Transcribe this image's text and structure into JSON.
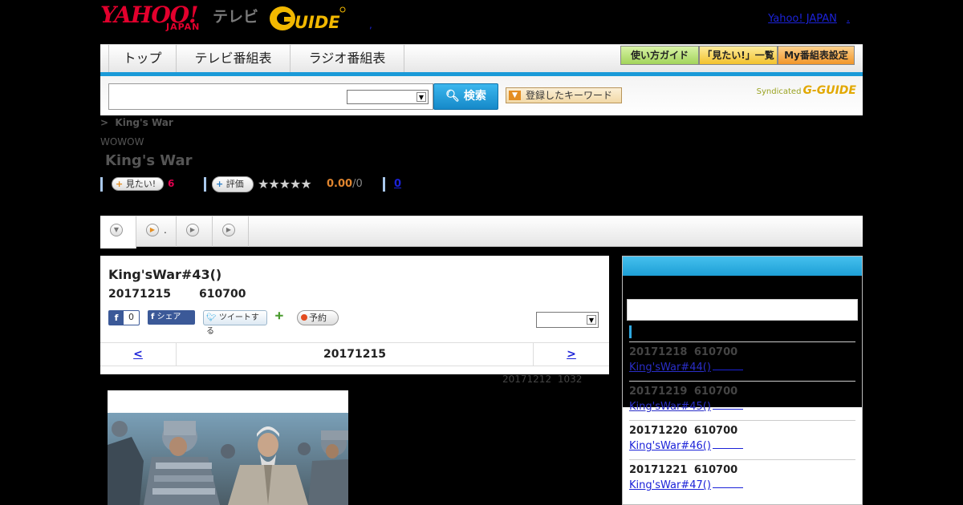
{
  "header": {
    "yahoo_logo": "YAHOO!",
    "japan_logo": "JAPAN",
    "tv_label": "テレビ",
    "gguide_logo": "G-GUIDE",
    "yahoo_japan_link": "Yahoo! JAPAN",
    "small_dot": ","
  },
  "nav": {
    "tabs": [
      {
        "label": "トップ"
      },
      {
        "label": "テレビ番組表"
      },
      {
        "label": "ラジオ番組表"
      }
    ],
    "buttons": [
      {
        "label": "使い方ガイド",
        "color": "#b5e36d"
      },
      {
        "label": "「見たい!」一覧",
        "color": "#f8d34a"
      },
      {
        "label": "My番組表設定",
        "color": "#f6a53a"
      }
    ]
  },
  "search": {
    "input_value": "",
    "select_value": "",
    "search_button": "検索",
    "keyword_button": "登録したキーワード",
    "syndicated_label": "Syndicated",
    "syndicated_brand": "G-GUIDE"
  },
  "breadcrumb": {
    "separator": ">",
    "current": "King's War"
  },
  "program": {
    "station": "WOWOW",
    "title": "King's War",
    "mitai_button": "見たい!",
    "mitai_count": "6",
    "hyouka_button": "評価",
    "stars": "★★★★★",
    "rating": 0.0,
    "score": "0.00",
    "score_count": "/0",
    "comment_count": "0"
  },
  "tabs": {
    "dot_label": "."
  },
  "episode": {
    "title": "King'sWar#43()",
    "date": "20171215",
    "time": "610700",
    "fb_like_count": "0",
    "fb_share": "シェア",
    "tweet": "ツイートする",
    "reserve": "予約",
    "select_value": "",
    "pager_prev": "<",
    "pager_current": "20171215",
    "pager_next": ">",
    "updated": "20171212  1032"
  },
  "sidebar": {
    "input_value": "",
    "items": [
      {
        "date": "20171218  610700",
        "link": "King'sWar#44()"
      },
      {
        "date": "20171219  610700",
        "link": "King'sWar#45()"
      },
      {
        "date": "20171220  610700",
        "link": "King'sWar#46()"
      },
      {
        "date": "20171221  610700",
        "link": "King'sWar#47()"
      }
    ]
  },
  "colors": {
    "accent_blue": "#1a9ad8",
    "yahoo_red": "#e3002d",
    "link": "#1b22d8"
  }
}
